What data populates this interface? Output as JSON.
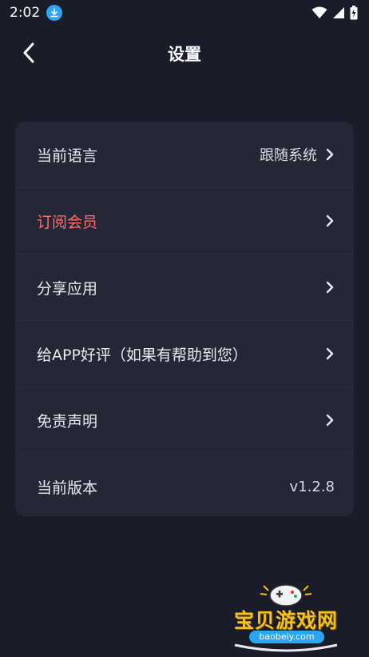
{
  "status": {
    "time": "2:02"
  },
  "header": {
    "title": "设置"
  },
  "settings": [
    {
      "label": "当前语言",
      "value": "跟随系统",
      "chevron": true
    },
    {
      "label": "订阅会员",
      "value": "",
      "chevron": true,
      "highlight": true
    },
    {
      "label": "分享应用",
      "value": "",
      "chevron": true
    },
    {
      "label": "给APP好评（如果有帮助到您）",
      "value": "",
      "chevron": true
    },
    {
      "label": "免责声明",
      "value": "",
      "chevron": true
    },
    {
      "label": "当前版本",
      "value": "v1.2.8",
      "chevron": false
    }
  ],
  "watermark": {
    "text": "宝贝游戏网",
    "sub": "baobeiy.com"
  },
  "colors": {
    "background": "#1b1c29",
    "card": "#262736",
    "highlight": "#ff6e6e",
    "accent": "#2aa6f2"
  }
}
